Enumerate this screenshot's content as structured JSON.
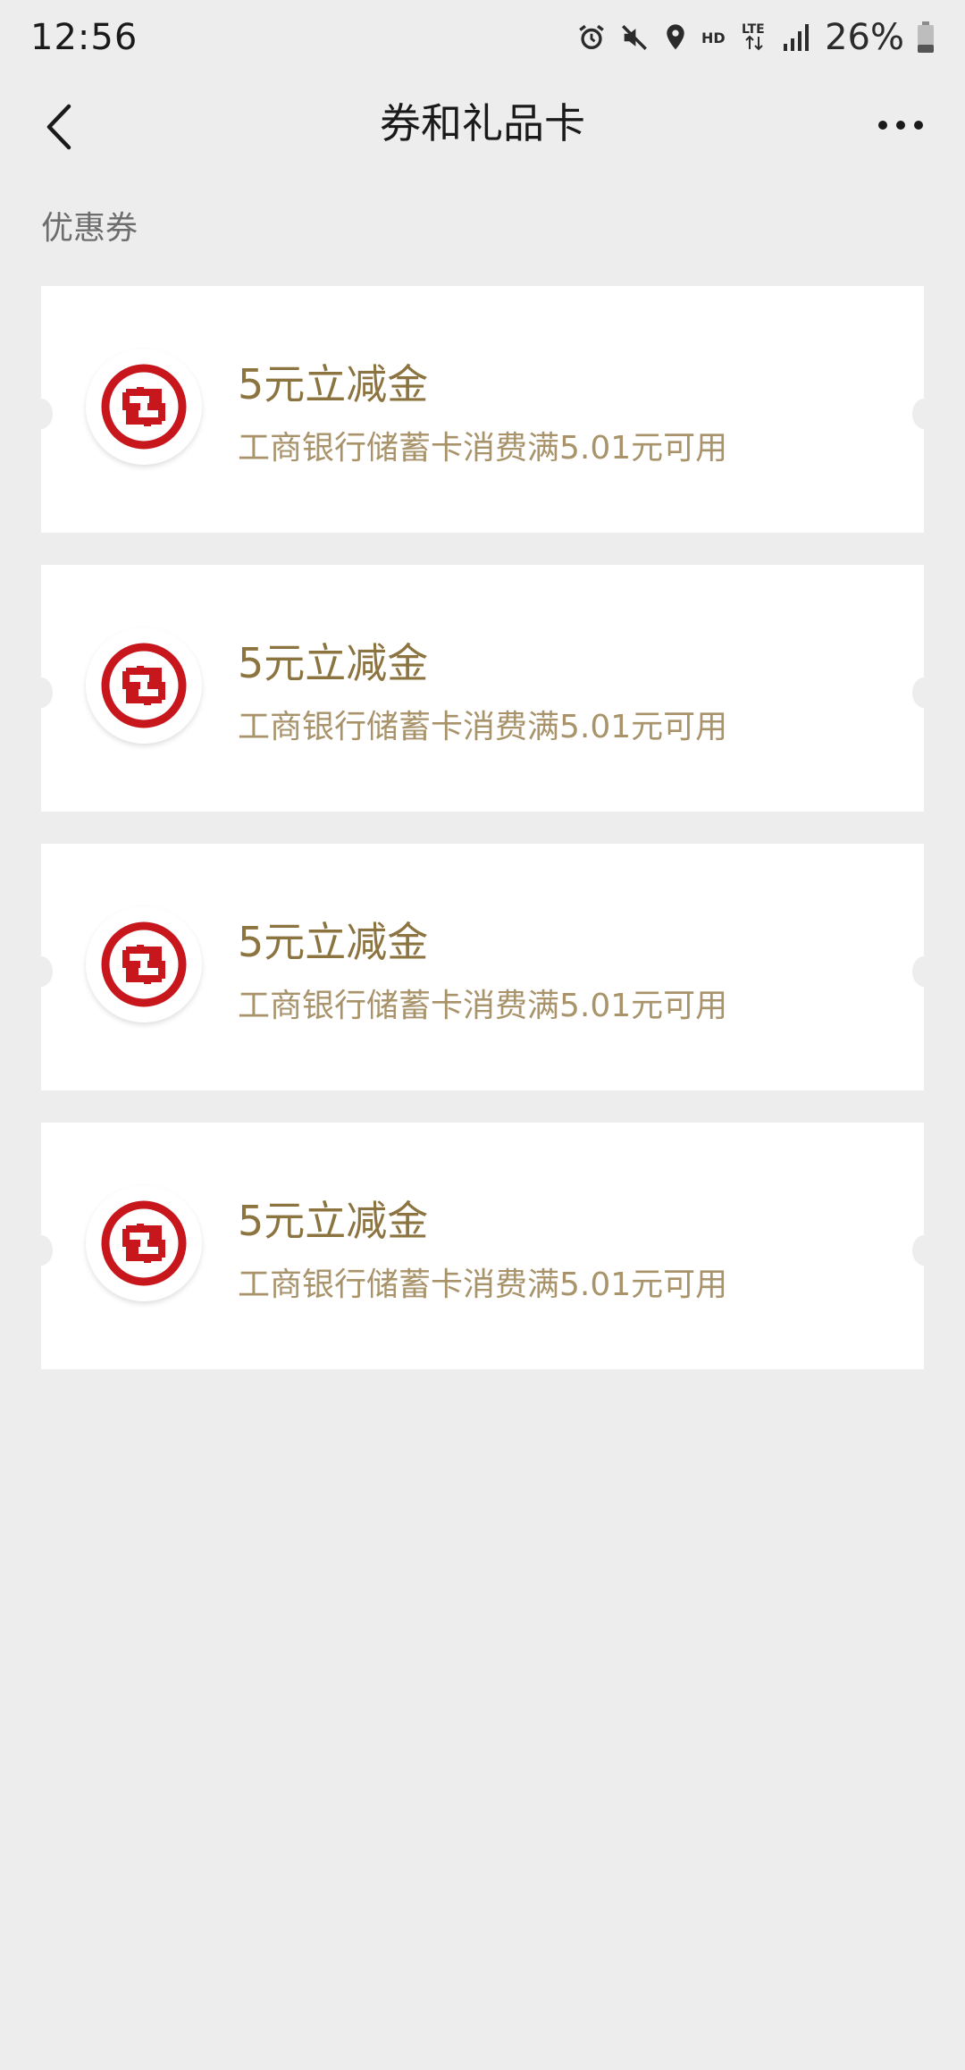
{
  "status_bar": {
    "time": "12:56",
    "icons": [
      "alarm-icon",
      "mute-icon",
      "location-icon",
      "hd-icon",
      "lte-icon",
      "signal-icon"
    ],
    "battery_percent": "26%"
  },
  "nav": {
    "title": "券和礼品卡"
  },
  "section": {
    "label": "优惠券"
  },
  "colors": {
    "background": "#ededed",
    "coupon_title": "#8c7440",
    "coupon_desc": "#a8936a",
    "logo_red": "#c8161d"
  },
  "coupons": [
    {
      "title": "5元立减金",
      "desc": "工商银行储蓄卡消费满5.01元可用",
      "logo": "icbc-logo-icon"
    },
    {
      "title": "5元立减金",
      "desc": "工商银行储蓄卡消费满5.01元可用",
      "logo": "icbc-logo-icon"
    },
    {
      "title": "5元立减金",
      "desc": "工商银行储蓄卡消费满5.01元可用",
      "logo": "icbc-logo-icon"
    },
    {
      "title": "5元立减金",
      "desc": "工商银行储蓄卡消费满5.01元可用",
      "logo": "icbc-logo-icon"
    }
  ]
}
